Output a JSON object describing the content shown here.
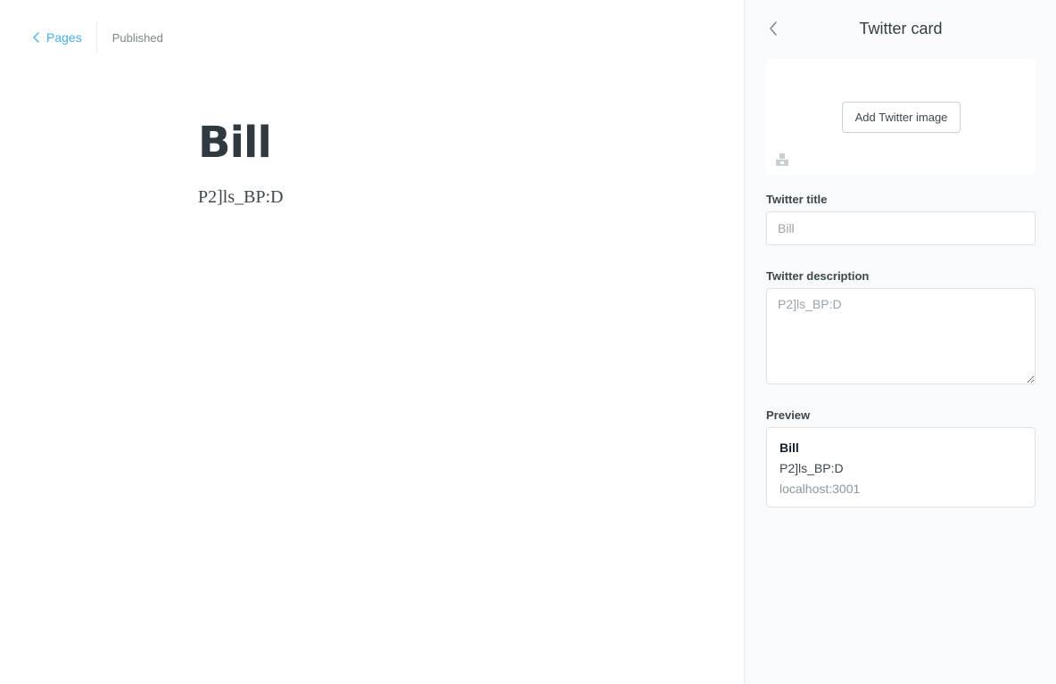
{
  "editor": {
    "back_label": "Pages",
    "status": "Published",
    "post_title": "Bill",
    "post_body": "P2]ls_BP:D"
  },
  "panel": {
    "title": "Twitter card",
    "add_image_label": "Add Twitter image",
    "twitter_title": {
      "label": "Twitter title",
      "placeholder": "Bill",
      "value": ""
    },
    "twitter_description": {
      "label": "Twitter description",
      "placeholder": "P2]ls_BP:D",
      "value": ""
    },
    "preview": {
      "label": "Preview",
      "title": "Bill",
      "description": "P2]ls_BP:D",
      "url": "localhost:3001"
    }
  },
  "colors": {
    "accent": "#3eb0ef",
    "panel_bg": "#f8fafb"
  },
  "icons": [
    "chevron-left-icon",
    "image-placeholder-icon"
  ]
}
